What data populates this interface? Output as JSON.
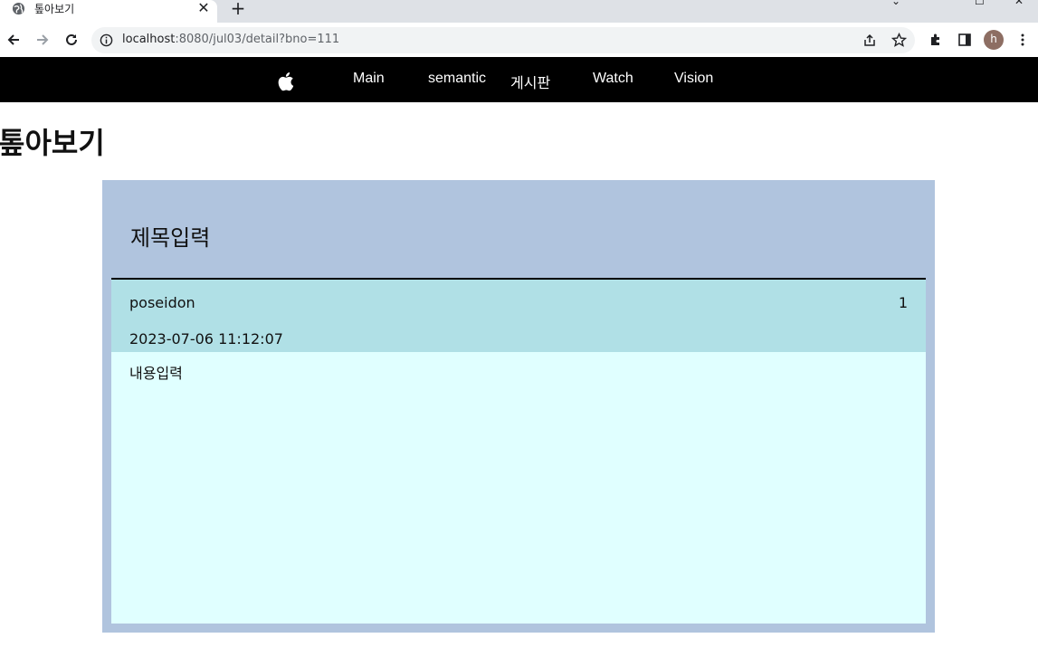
{
  "browser": {
    "tab_title": "톺아보기",
    "url_host": "localhost",
    "url_path": ":8080/jul03/detail?bno=111",
    "profile_initial": "h",
    "avatar_color": "#8d6e63"
  },
  "navbar": {
    "items": [
      "Main",
      "semantic",
      "게시판",
      "Watch",
      "Vision"
    ]
  },
  "page": {
    "heading": "톺아보기"
  },
  "post": {
    "title": "제목입력",
    "writer": "poseidon",
    "count": "1",
    "date": "2023-07-06 11:12:07",
    "content": "내용입력"
  },
  "colors": {
    "detail_bg": "#b0c4de",
    "meta_bg": "#b0e0e6",
    "content_bg": "#e0ffff",
    "navbar_bg": "#000000"
  }
}
